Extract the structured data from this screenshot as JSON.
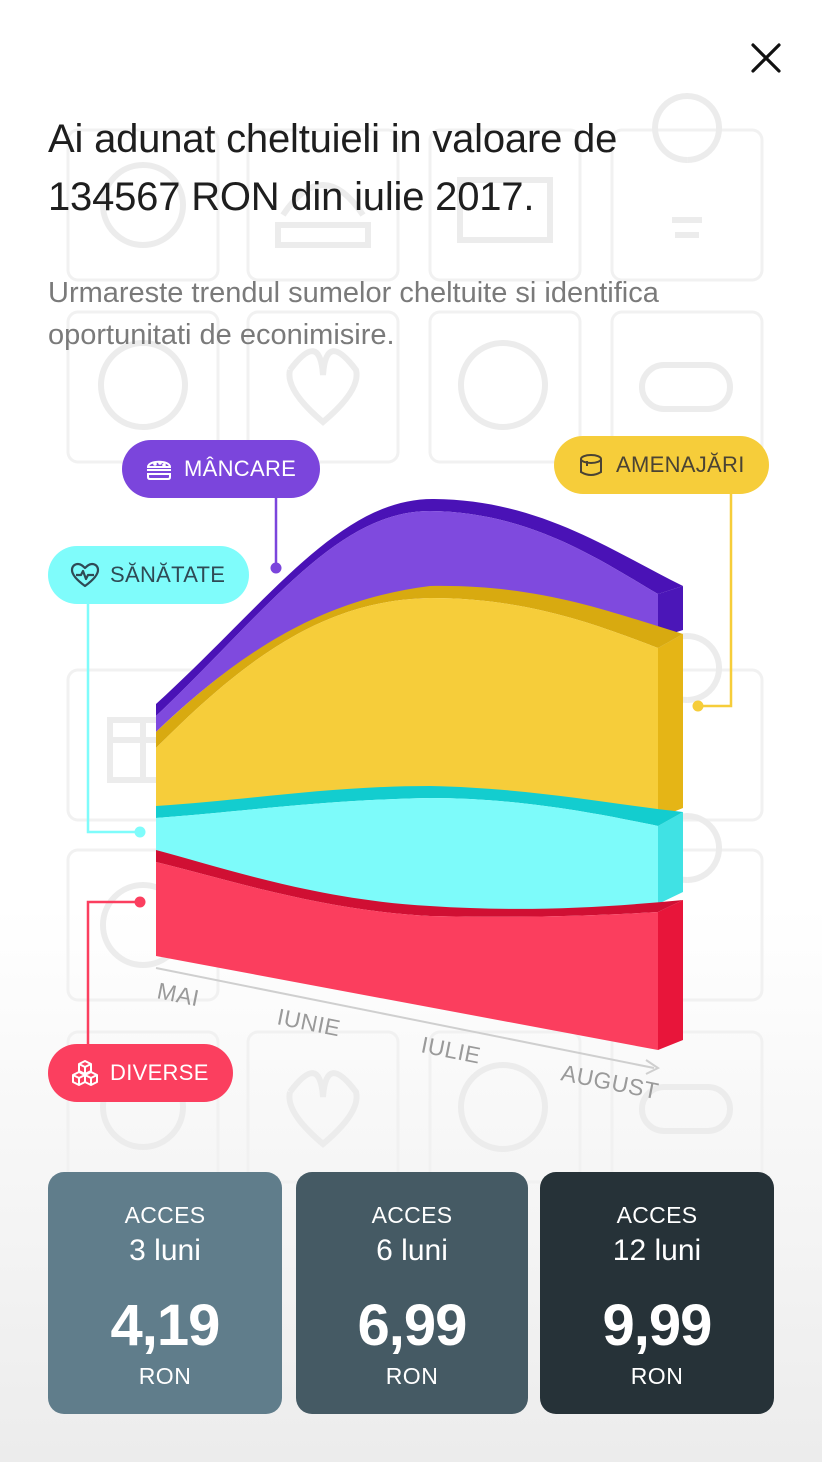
{
  "header": {
    "title_line1": "Ai adunat cheltuieli in valoare de",
    "title_line2": "134567 RON din iulie 2017.",
    "subtitle_line1": "Urmareste trendul sumelor cheltuite si identifica",
    "subtitle_line2": "oportunitati de econimisire."
  },
  "chart_data": {
    "type": "area",
    "categories": [
      "MAI",
      "IUNIE",
      "IULIE",
      "AUGUST"
    ],
    "series": [
      {
        "name": "DIVERSE",
        "color": "#fb3f5f"
      },
      {
        "name": "SĂNĂTATE",
        "color": "#7ffcfb"
      },
      {
        "name": "AMENAJĂRI",
        "color": "#f6cd3a"
      },
      {
        "name": "MÂNCARE",
        "color": "#7b45dc"
      }
    ],
    "stacked": true
  },
  "labels": {
    "mancare": "MÂNCARE",
    "sanatate": "SĂNĂTATE",
    "amenajari": "AMENAJĂRI",
    "diverse": "DIVERSE"
  },
  "plans": [
    {
      "acces": "ACCES",
      "period": "3 luni",
      "price": "4,19",
      "currency": "RON",
      "color": "#607d8b"
    },
    {
      "acces": "ACCES",
      "period": "6 luni",
      "price": "6,99",
      "currency": "RON",
      "color": "#455a64"
    },
    {
      "acces": "ACCES",
      "period": "12 luni",
      "price": "9,99",
      "currency": "RON",
      "color": "#263238"
    }
  ],
  "icons": {
    "close": "close-icon",
    "mancare": "burger-icon",
    "sanatate": "heart-pulse-icon",
    "amenajari": "paint-bucket-icon",
    "diverse": "cubes-icon"
  }
}
